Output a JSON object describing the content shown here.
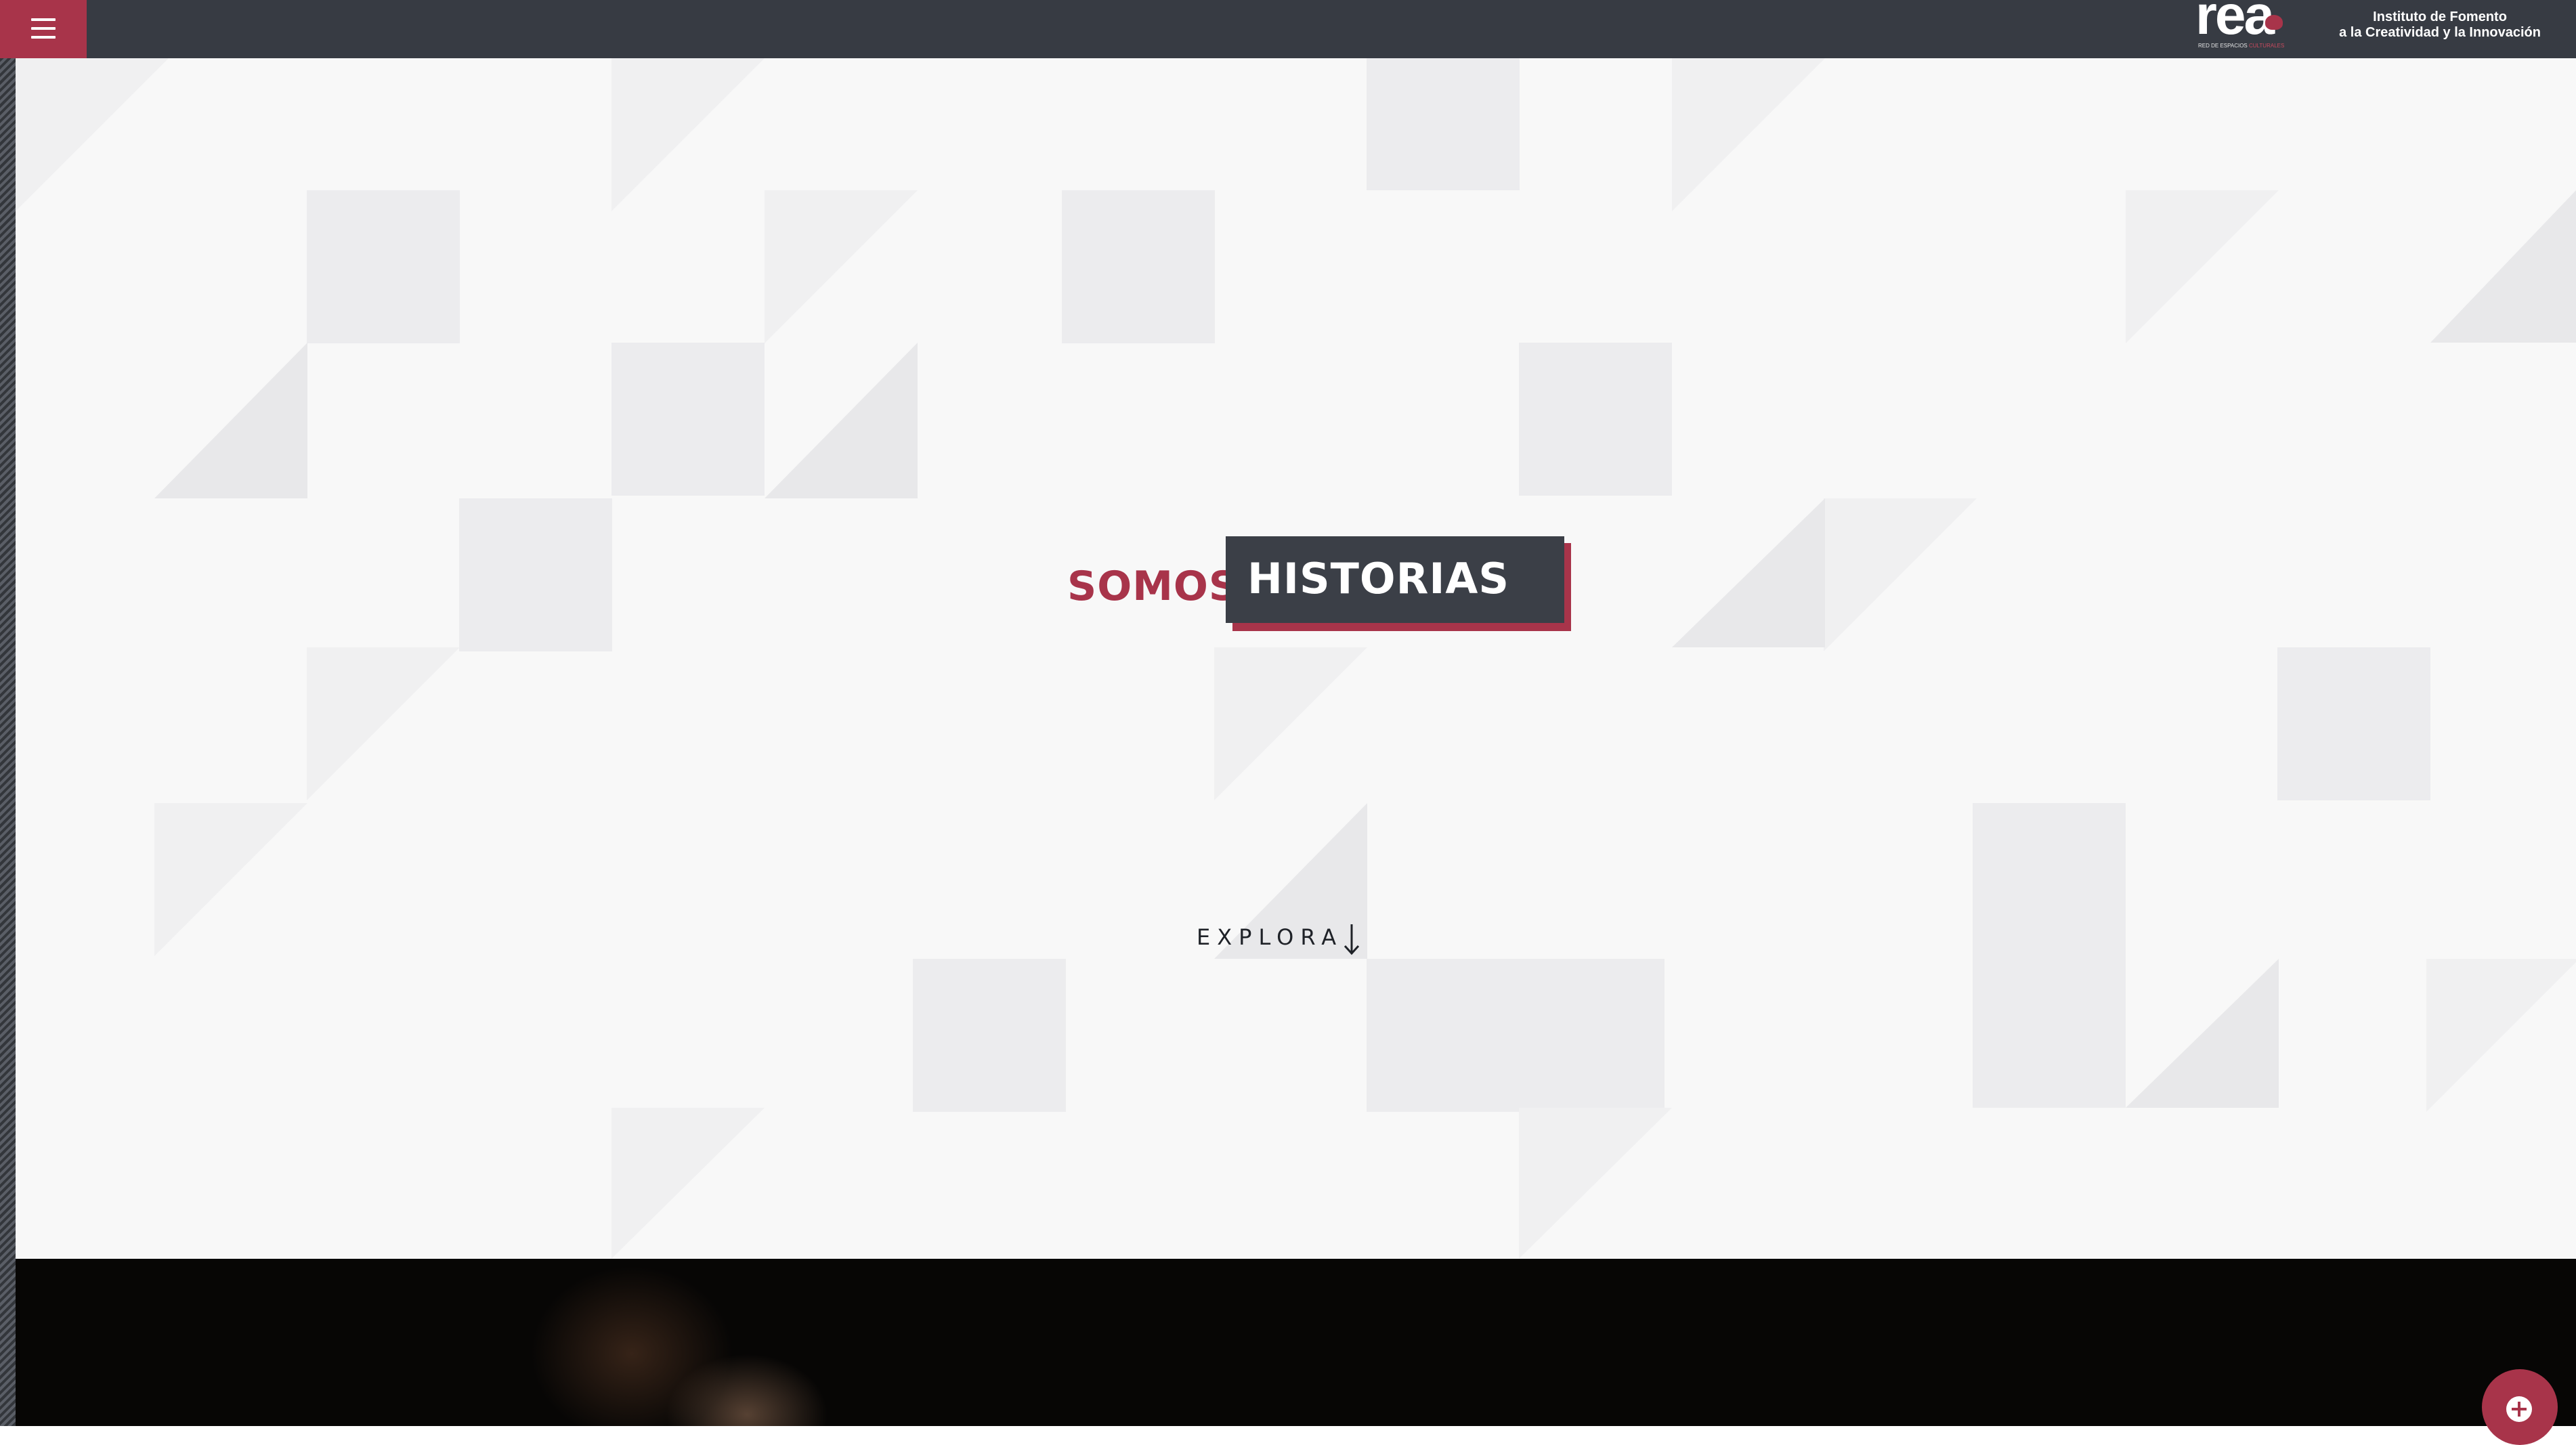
{
  "header": {
    "menu_icon": "hamburger-menu-icon",
    "logo": {
      "main_text": "rea",
      "sub_text": "RED DE ESPACIOS",
      "sub_text_accent": "CULTURALES",
      "accent_color": "#a8344a"
    },
    "institute_line1": "Instituto de Fomento",
    "institute_line2": "a la Creatividad y la Innovación"
  },
  "hero": {
    "prefix": "SOMOS",
    "highlight": "HISTORIAS",
    "explore_label": "EXPLORA",
    "explore_icon": "arrow-down-icon"
  },
  "fab": {
    "icon": "plus-circle-icon"
  },
  "colors": {
    "brand": "#a8344a",
    "header_bg": "#373b43",
    "highlight_box": "#3b3f47",
    "dark_section": "#070605"
  }
}
